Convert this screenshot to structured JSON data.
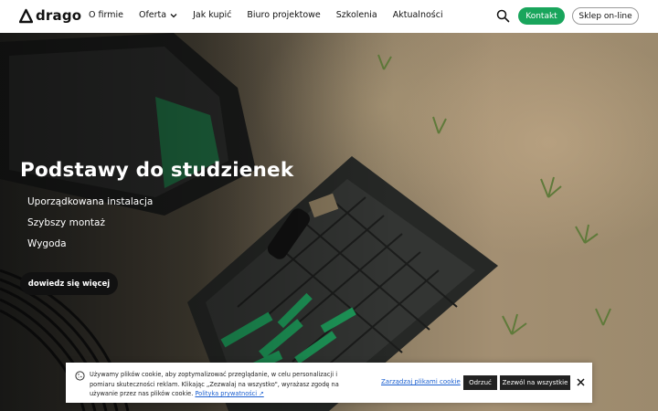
{
  "brand": {
    "logo_text": "drago",
    "logo_icon": "drago-logo-mark"
  },
  "nav": {
    "items": [
      {
        "label": "O firmie"
      },
      {
        "label": "Oferta",
        "icon": "chevron-down-icon"
      },
      {
        "label": "Jak kupić"
      },
      {
        "label": "Biuro projektowe"
      },
      {
        "label": "Szkolenia"
      },
      {
        "label": "Aktualności"
      }
    ],
    "search_icon": "search-icon",
    "contact_label": "Kontakt",
    "shop_label": "Sklep on-line"
  },
  "hero": {
    "title": "Podstawy do studzienek",
    "features": [
      "Uporządkowana instalacja",
      "Szybszy montaż",
      "Wygoda"
    ],
    "cta_label": "dowiedz się więcej"
  },
  "cookie_bar": {
    "icon": "cookie-icon",
    "text": "Używamy plików cookie, aby zoptymalizować przeglądanie, w celu personalizacji i pomiaru skuteczności reklam. Klikając „Zezwalaj na wszystko\", wyrażasz zgodę na używanie przez nas plików cookie.",
    "privacy_link": "Polityka prywatności ↗",
    "manage_label": "Zarządzaj plikami cookie",
    "reject_label": "Odrzuć",
    "accept_label": "Zezwól na wszystkie",
    "close_icon": "close-icon"
  },
  "colors": {
    "accent_green": "#19a55c",
    "dark_button": "#111111",
    "link_blue": "#1a5fd0"
  }
}
